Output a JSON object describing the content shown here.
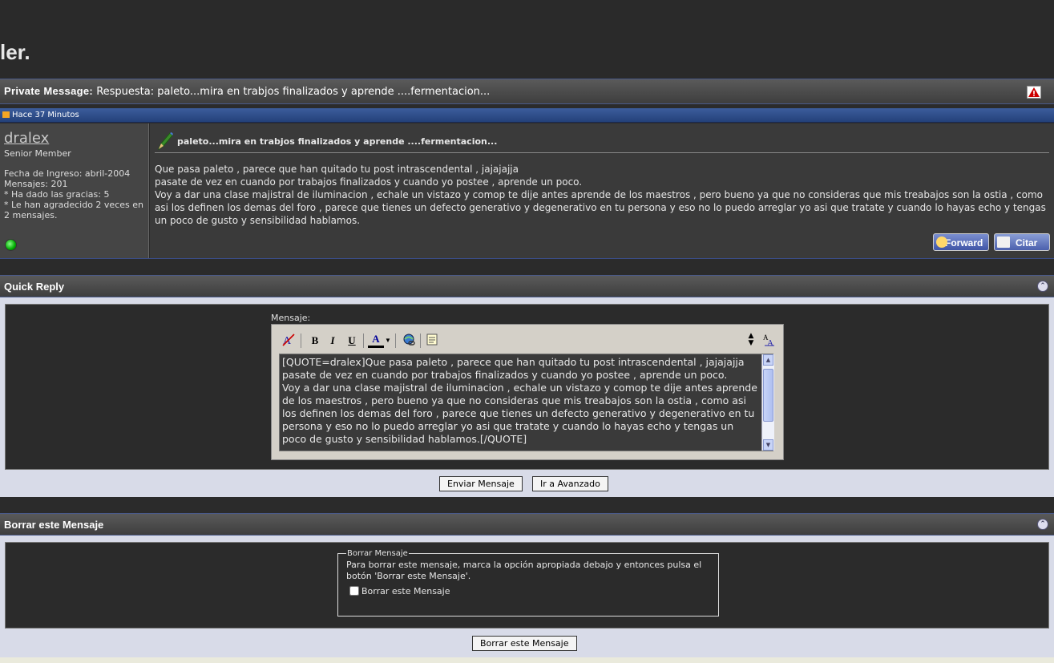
{
  "banner": {
    "title": "ler."
  },
  "pm_bar": {
    "label": "Private Message",
    "colon": ":",
    "subject": "Respuesta: paleto...mira en trabjos finalizados y aprende ....fermentacion..."
  },
  "date_bar": {
    "text": "Hace 37 Minutos"
  },
  "post": {
    "username": "dralex",
    "usertitle": "Senior Member",
    "join_date": "Fecha de Ingreso: abril-2004",
    "messages": "Mensajes: 201",
    "thanks_given": "* Ha dado las gracias: 5",
    "thanks_received": "* Le han agradecido 2 veces en 2 mensajes.",
    "title": "paleto...mira en trabjos finalizados y aprende ....fermentacion...",
    "body_lines": [
      "Que pasa paleto , parece que han quitado tu post intrascendental , jajajajja",
      "pasate de vez en cuando por trabajos finalizados y cuando yo postee , aprende un poco.",
      "Voy a dar una clase majistral de iluminacion , echale un vistazo y comop te dije antes aprende de los maestros , pero bueno ya que no consideras que mis treabajos son la ostia , como asi los definen los demas del foro , parece que tienes un defecto generativo y degenerativo en tu persona y eso no lo puedo arreglar yo asi que tratate y cuando lo hayas echo y tengas un poco de gusto y sensibilidad hablamos."
    ],
    "forward_label": "Forward",
    "quote_label": "Citar"
  },
  "quick_reply": {
    "title": "Quick Reply",
    "message_label": "Mensaje:",
    "toolbar": {
      "bold": "B",
      "italic": "I",
      "underline": "U",
      "font_color": "A"
    },
    "textarea_value": "[QUOTE=dralex]Que pasa paleto , parece que han quitado tu post intrascendental , jajajajja\npasate de vez en cuando por trabajos finalizados y cuando yo postee , aprende un poco.\nVoy a dar una clase majistral de iluminacion , echale un vistazo y comop te dije antes aprende de los maestros , pero bueno ya que no consideras que mis treabajos son la ostia , como asi los definen los demas del foro , parece que tienes un defecto generativo y degenerativo en tu persona y eso no lo puedo arreglar yo asi que tratate y cuando lo hayas echo y tengas un poco de gusto y sensibilidad hablamos.[/QUOTE]",
    "send_button": "Enviar Mensaje",
    "advanced_button": "Ir a Avanzado"
  },
  "delete": {
    "title": "Borrar este Mensaje",
    "legend": "Borrar Mensaje",
    "description": "Para borrar este mensaje, marca la opción apropiada debajo y entonces pulsa el botón 'Borrar este Mensaje'.",
    "checkbox_label": "Borrar este Mensaje",
    "button": "Borrar este Mensaje"
  },
  "colors": {
    "accent_blue": "#24417a",
    "panel_bg": "#d8dbe8",
    "dark_bg": "#2b2b2b"
  }
}
